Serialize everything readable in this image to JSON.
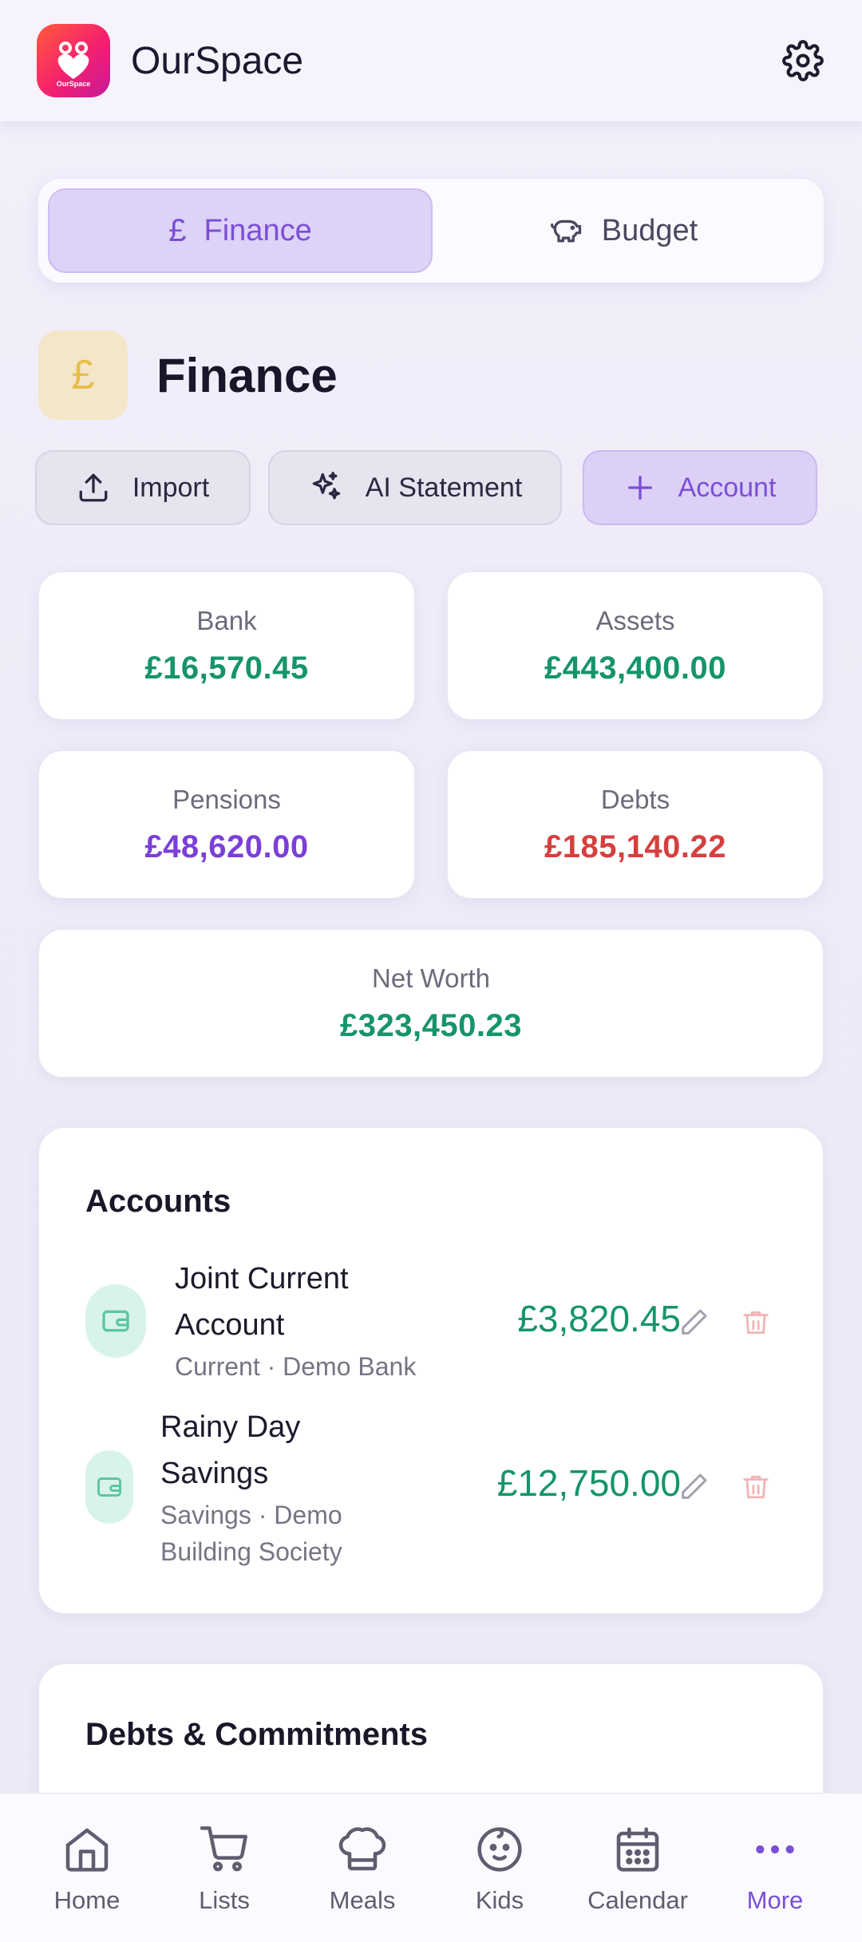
{
  "header": {
    "app_title": "OurSpace",
    "logo_text": "OurSpace"
  },
  "segmented": {
    "tabs": [
      {
        "label": "Finance",
        "icon": "pound-icon",
        "active": true
      },
      {
        "label": "Budget",
        "icon": "piggy-bank-icon",
        "active": false
      }
    ]
  },
  "page": {
    "title": "Finance",
    "icon_glyph": "£"
  },
  "actions": {
    "import_label": "Import",
    "ai_label": "AI Statement",
    "add_label": "Account"
  },
  "stats": {
    "bank": {
      "label": "Bank",
      "value": "£16,570.45"
    },
    "assets": {
      "label": "Assets",
      "value": "£443,400.00"
    },
    "pensions": {
      "label": "Pensions",
      "value": "£48,620.00"
    },
    "debts": {
      "label": "Debts",
      "value": "£185,140.22"
    },
    "net_worth": {
      "label": "Net Worth",
      "value": "£323,450.23"
    }
  },
  "accounts": {
    "title": "Accounts",
    "items": [
      {
        "name_line1": "Joint Current",
        "name_line2": "Account",
        "sub_line1": "Current · Demo Bank",
        "sub_line2": "",
        "amount": "£3,820.45"
      },
      {
        "name_line1": "Rainy Day",
        "name_line2": "Savings",
        "sub_line1": "Savings · Demo",
        "sub_line2": "Building Society",
        "amount": "£12,750.00"
      }
    ]
  },
  "debts_section": {
    "title": "Debts & Commitments"
  },
  "nav": {
    "items": [
      {
        "label": "Home",
        "icon": "home-icon"
      },
      {
        "label": "Lists",
        "icon": "cart-icon"
      },
      {
        "label": "Meals",
        "icon": "chef-hat-icon"
      },
      {
        "label": "Kids",
        "icon": "baby-face-icon"
      },
      {
        "label": "Calendar",
        "icon": "calendar-icon"
      },
      {
        "label": "More",
        "icon": "more-dots-icon",
        "active": true
      }
    ]
  },
  "colors": {
    "accent": "#7a4fd6",
    "positive": "#16946a",
    "negative": "#d63f3f",
    "pension": "#7b3fd8"
  }
}
